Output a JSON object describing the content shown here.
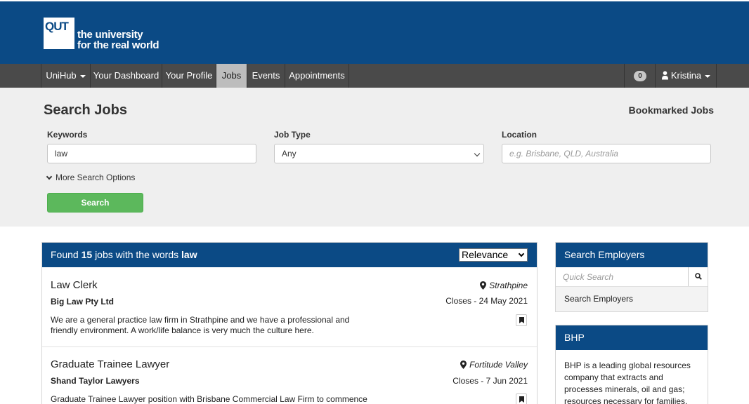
{
  "logo": {
    "mark": "QUT",
    "line1": "the university",
    "line2": "for the real world"
  },
  "nav": {
    "items": [
      "UniHub",
      "Your Dashboard",
      "Your Profile",
      "Jobs",
      "Events",
      "Appointments"
    ],
    "active": "Jobs",
    "notification_count": "0",
    "user_name": "Kristina"
  },
  "search": {
    "title": "Search Jobs",
    "bookmarked_link": "Bookmarked Jobs",
    "keywords_label": "Keywords",
    "keywords_value": "law",
    "job_type_label": "Job Type",
    "job_type_value": "Any",
    "location_label": "Location",
    "location_placeholder": "e.g. Brisbane, QLD, Australia",
    "more_options": "More Search Options",
    "search_button": "Search"
  },
  "results": {
    "prefix": "Found",
    "count": "15",
    "middle": "jobs with the words",
    "term": "law",
    "sort_value": "Relevance",
    "jobs": [
      {
        "title": "Law Clerk",
        "company": "Big Law Pty Ltd",
        "location": "Strathpine",
        "closes": "Closes - 24 May 2021",
        "description": "We are a general practice law firm in Strathpine and we have a professional and friendly environment. A work/life balance is very much the culture here."
      },
      {
        "title": "Graduate Trainee Lawyer",
        "company": "Shand Taylor Lawyers",
        "location": "Fortitude Valley",
        "closes": "Closes - 7 Jun 2021",
        "description": "Graduate Trainee Lawyer position with Brisbane Commercial Law Firm to commence"
      }
    ]
  },
  "sidebar": {
    "employers_header": "Search Employers",
    "quick_search_placeholder": "Quick Search",
    "employers_link": "Search Employers",
    "featured_header": "BHP",
    "featured_text": "BHP is a leading global resources company that extracts and processes minerals, oil and gas; resources necessary for families,"
  },
  "colors": {
    "brand_blue": "#0b4a85",
    "nav_gray": "#4a4a4a",
    "search_green": "#5cb85c"
  }
}
